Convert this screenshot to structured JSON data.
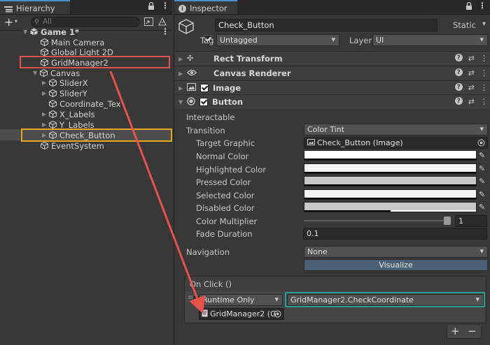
{
  "hierarchy": {
    "tab_label": "Hierarchy",
    "search_placeholder": "All",
    "scene": "Game 1*",
    "items": {
      "main_camera": "Main Camera",
      "global_light": "Global Light 2D",
      "grid_manager": "GridManager2",
      "canvas": "Canvas",
      "slider_x": "SliderX",
      "slider_y": "SliderY",
      "coordinate_text": "Coordinate_Tex",
      "x_labels": "X_Labels",
      "y_labels": "Y_Labels",
      "check_button": "Check_Button",
      "event_system": "EventSystem"
    }
  },
  "inspector": {
    "tab_label": "Inspector",
    "object_name": "Check_Button",
    "static_label": "Static",
    "tag_label": "Tag",
    "tag_value": "Untagged",
    "layer_label": "Layer",
    "layer_value": "UI",
    "components": {
      "rect_transform": "Rect Transform",
      "canvas_renderer": "Canvas Renderer",
      "image": "Image",
      "button": "Button"
    },
    "button": {
      "interactable_label": "Interactable",
      "transition_label": "Transition",
      "transition_value": "Color Tint",
      "target_graphic_label": "Target Graphic",
      "target_graphic_value": "Check_Button (Image)",
      "normal_color_label": "Normal Color",
      "highlighted_color_label": "Highlighted Color",
      "pressed_color_label": "Pressed Color",
      "selected_color_label": "Selected Color",
      "disabled_color_label": "Disabled Color",
      "color_multiplier_label": "Color Multiplier",
      "color_multiplier_value": "1",
      "color_multiplier_fraction": 1.0,
      "fade_duration_label": "Fade Duration",
      "fade_duration_value": "0.1",
      "navigation_label": "Navigation",
      "navigation_value": "None",
      "visualize_label": "Visualize"
    },
    "on_click": {
      "header": "On Click ()",
      "runtime_value": "Runtime Only",
      "function_value": "GridManager2.CheckCoordinate",
      "object_value": "GridManager2 (G",
      "plus_label": "+",
      "minus_label": "−"
    }
  },
  "colors": {
    "normal": "#ffffff",
    "highlighted": "#f5f5f5",
    "pressed": "#c8c8c8",
    "selected": "#f5f5f5",
    "disabled": "#c8c8c8",
    "annotation_red": "#e8524a",
    "annotation_orange": "#e6a817",
    "annotation_teal": "#23a08f",
    "visualize_button": "#4a6075"
  }
}
